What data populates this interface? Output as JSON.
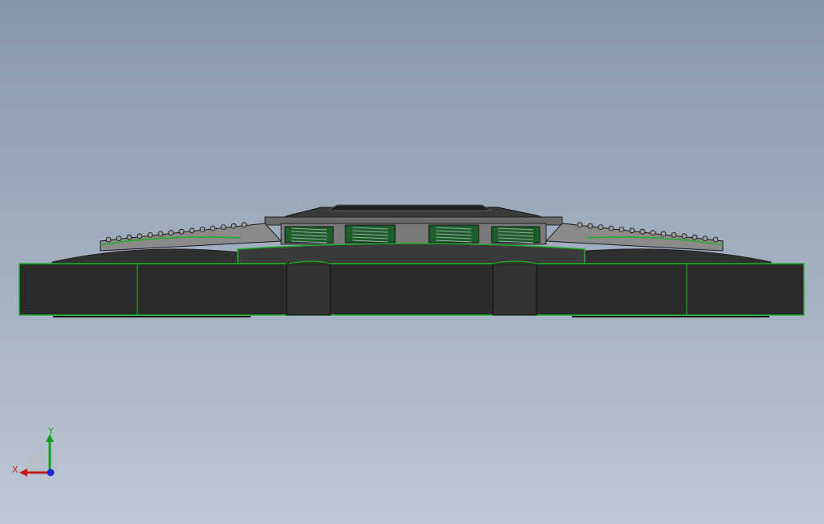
{
  "viewport": {
    "background_top": "#8797ab",
    "background_bottom": "#bec8d4"
  },
  "model": {
    "body_color": "#2c2c2c",
    "edge_color": "#1fae2c",
    "hardware_color": "#9a9a9a",
    "spring_color": "#1c5e2a"
  },
  "triad": {
    "x_label": "X",
    "y_label": "Y",
    "x_color": "#c41a1a",
    "y_color": "#10a020",
    "z_color": "#1a2ad0"
  }
}
